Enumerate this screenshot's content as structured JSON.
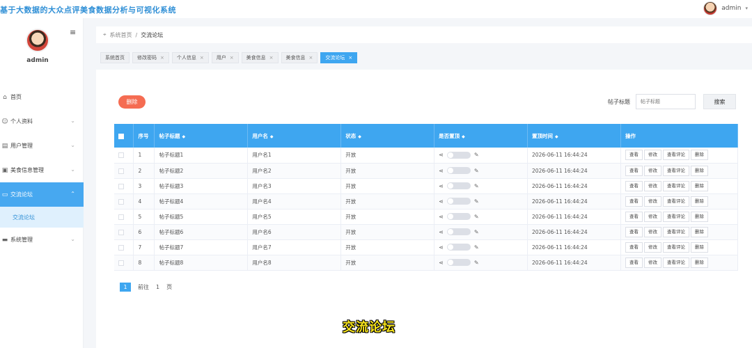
{
  "app": {
    "title": "基于大数据的大众点评美食数据分析与可视化系统",
    "user": "admin"
  },
  "sidebar": {
    "username": "admin",
    "items": [
      {
        "label": "首页",
        "icon": "home-icon",
        "expandable": false
      },
      {
        "label": "个人资料",
        "icon": "user-icon",
        "expandable": true
      },
      {
        "label": "用户管理",
        "icon": "users-icon",
        "expandable": true
      },
      {
        "label": "美食信息管理",
        "icon": "food-icon",
        "expandable": true
      },
      {
        "label": "交流论坛",
        "icon": "forum-icon",
        "expandable": true,
        "active": true
      },
      {
        "label": "系统管理",
        "icon": "system-icon",
        "expandable": true
      }
    ],
    "submenu": {
      "label": "交流论坛"
    }
  },
  "breadcrumb": {
    "home": "系统首页",
    "separator": "/",
    "current": "交流论坛"
  },
  "tags": [
    {
      "label": "系统首页",
      "closable": false,
      "active": false
    },
    {
      "label": "修改密码",
      "closable": true,
      "active": false
    },
    {
      "label": "个人信息",
      "closable": true,
      "active": false
    },
    {
      "label": "用户",
      "closable": true,
      "active": false
    },
    {
      "label": "美食信息",
      "closable": true,
      "active": false
    },
    {
      "label": "美食信息",
      "closable": true,
      "active": false
    },
    {
      "label": "交流论坛",
      "closable": true,
      "active": true
    }
  ],
  "toolbar": {
    "delete_label": "删除",
    "search_label": "帖子标题",
    "search_placeholder": "帖子标题",
    "search_button": "搜索"
  },
  "table": {
    "headers": [
      "序号",
      "帖子标题",
      "用户名",
      "状态",
      "是否置顶",
      "置顶时间",
      "操作"
    ],
    "rows": [
      {
        "index": "1",
        "title": "帖子标题1",
        "user": "用户名1",
        "status": "开放",
        "top_time": "2026-06-11 16:44:24"
      },
      {
        "index": "2",
        "title": "帖子标题2",
        "user": "用户名2",
        "status": "开放",
        "top_time": "2026-06-11 16:44:24"
      },
      {
        "index": "3",
        "title": "帖子标题3",
        "user": "用户名3",
        "status": "开放",
        "top_time": "2026-06-11 16:44:24"
      },
      {
        "index": "4",
        "title": "帖子标题4",
        "user": "用户名4",
        "status": "开放",
        "top_time": "2026-06-11 16:44:24"
      },
      {
        "index": "5",
        "title": "帖子标题5",
        "user": "用户名5",
        "status": "开放",
        "top_time": "2026-06-11 16:44:24"
      },
      {
        "index": "6",
        "title": "帖子标题6",
        "user": "用户名6",
        "status": "开放",
        "top_time": "2026-06-11 16:44:24"
      },
      {
        "index": "7",
        "title": "帖子标题7",
        "user": "用户名7",
        "status": "开放",
        "top_time": "2026-06-11 16:44:24"
      },
      {
        "index": "8",
        "title": "帖子标题8",
        "user": "用户名8",
        "status": "开放",
        "top_time": "2026-06-11 16:44:24"
      }
    ],
    "actions": [
      "查看",
      "修改",
      "查看评论",
      "删除"
    ]
  },
  "pagination": {
    "current": "1",
    "goto_label": "前往",
    "goto_value": "1",
    "page_suffix": "页"
  },
  "caption": "交流论坛",
  "colors": {
    "primary": "#3ea6f0",
    "danger": "#f56c52",
    "title": "#2f8fd6",
    "caption": "#f7e41c"
  }
}
